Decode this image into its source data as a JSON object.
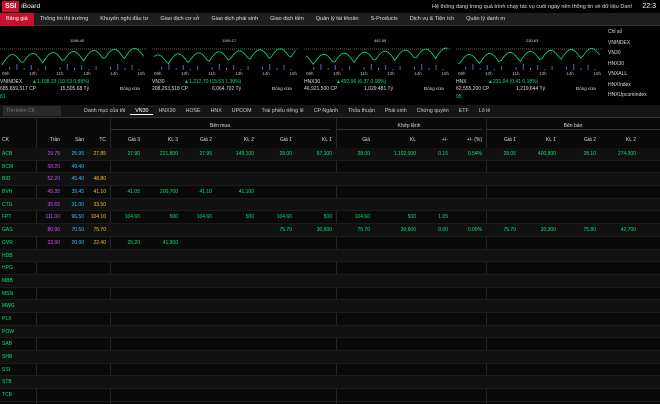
{
  "app": {
    "logo": "SSI",
    "name": "iBoard",
    "ticker_text": "Hệ thống đang trong quá trình chạy tác vụ cuối ngày nên thông tin về dữ liệu Danh m",
    "clock": "22:3"
  },
  "menu": [
    "Bảng giá",
    "Thông tin thị trường",
    "Khuyến nghị đầu tư",
    "Giao dịch cơ sở",
    "Giao dịch phái sinh",
    "Giao dịch tiền",
    "Quản lý tài khoản",
    "S-Products",
    "Dịch vụ & Tiện ích",
    "Quản lý danh m"
  ],
  "hours": [
    "09h",
    "10h",
    "11h",
    "13h",
    "14h",
    "15h"
  ],
  "indices": [
    {
      "name": "VNINDEX",
      "change": "▲1,198.33 (10.53 0.88%)",
      "vol": "685,659,517 CP",
      "val": "15,505.68 Tỷ",
      "status": "Đóng cửa",
      "peak": "1198.40",
      "advance": "81",
      "ceil": "",
      "nochange": "",
      "decline": "",
      "floor": ""
    },
    {
      "name": "VN30",
      "change": "▲1,212.70 (15.53 1.30%)",
      "vol": "208,253,518 CP",
      "val": "6,064.702 Tỷ",
      "status": "Đóng cửa",
      "peak": "1199.17",
      "advance": "",
      "ceil": "",
      "nochange": "",
      "decline": "",
      "floor": ""
    },
    {
      "name": "HNX30",
      "change": "▲492.96 (6.37 0.08%)",
      "vol": "46,921,500 CP",
      "val": "1,029.481 Tỷ",
      "status": "Đóng cửa",
      "peak": "492.59",
      "advance": "",
      "ceil": "",
      "nochange": "",
      "decline": "",
      "floor": ""
    },
    {
      "name": "HNX",
      "change": "▲231.04 (0.41 0.18%)",
      "vol": "62,555,200 CP",
      "val": "1,219,644 Tỷ",
      "status": "Đóng cửa",
      "peak": "230.63",
      "advance": "95",
      "ceil": "",
      "nochange": "",
      "decline": "",
      "floor": ""
    }
  ],
  "index_list": [
    "Chỉ số",
    "VNINDEX",
    "VN30",
    "HNX30",
    "VNXALL",
    "HNXIndex",
    "HNXUpcomIndex"
  ],
  "filter": {
    "search_placeholder": "Tìm kiếm CK",
    "tabs": [
      "Danh mục của tôi",
      "VN30",
      "HNX30",
      "HOSE",
      "HNX",
      "UPCOM",
      "Trái phiếu riêng lẻ",
      "CP Ngành",
      "Thỏa thuận",
      "Phái sinh",
      "Chứng quyền",
      "ETF",
      "Lô lẻ"
    ]
  },
  "headers": {
    "ck": "CK",
    "tran": "Trần",
    "san": "Sàn",
    "tc": "TC",
    "ben_mua": "Bên mua",
    "khop_lenh": "Khớp lệnh",
    "ben_ban": "Bên bán",
    "gia3": "Giá 3",
    "kl3": "KL 3",
    "gia2": "Giá 2",
    "kl2": "KL 2",
    "gia1": "Giá 1",
    "kl1": "KL 1",
    "gia": "Giá",
    "kl": "KL",
    "pm": "+/-",
    "pct": "+/- (%)",
    "sgia1": "Giá 1",
    "skl1": "KL 1",
    "sgia2": "Giá 2",
    "skl2": "KL 2"
  },
  "rows": [
    [
      "ACB",
      "29.75",
      "25.95",
      "27.85",
      "27.90",
      "221,800",
      "27.95",
      "149,100",
      "28.00",
      "57,100",
      "28.00",
      "1,102,000",
      "0.15",
      "0.54%",
      "28.05",
      "400,800",
      "28.10",
      "274,300"
    ],
    [
      "BCM",
      "58.20",
      "49.40",
      "",
      "",
      "",
      "",
      "",
      "",
      "",
      "",
      "",
      "",
      "",
      "",
      "",
      "",
      ""
    ],
    [
      "BID",
      "52.20",
      "45.40",
      "48.80",
      "",
      "",
      "",
      "",
      "",
      "",
      "",
      "",
      "",
      "",
      "",
      "",
      "",
      ""
    ],
    [
      "BVH",
      "45.35",
      "39.45",
      "41.10",
      "41.05",
      "200,700",
      "41.10",
      "41,100",
      "",
      "",
      "",
      "",
      "",
      "",
      "",
      "",
      "",
      ""
    ],
    [
      "CTG",
      "35.65",
      "31.00",
      "33.50",
      "",
      "",
      "",
      "",
      "",
      "",
      "",
      "",
      "",
      "",
      "",
      "",
      "",
      ""
    ],
    [
      "FPT",
      "111.00",
      "96.50",
      "104.10",
      "104.60",
      "500",
      "104.60",
      "500",
      "104.60",
      "500",
      "104.60",
      "500",
      "1.05",
      "",
      "",
      "",
      "",
      ""
    ],
    [
      "GAS",
      "80.90",
      "70.50",
      "75.70",
      "",
      "",
      "",
      "",
      "75.70",
      "30,600",
      "75.70",
      "30,600",
      "0.00",
      "0.00%",
      "75.70",
      "20,300",
      "75.80",
      "42,700"
    ],
    [
      "GVR",
      "23.90",
      "20.90",
      "22.40",
      "25.20",
      "41,900",
      "",
      "",
      "",
      "",
      "",
      "",
      "",
      "",
      "",
      "",
      "",
      ""
    ],
    [
      "HDB",
      "",
      "",
      "",
      "",
      "",
      "",
      "",
      "",
      "",
      "",
      "",
      "",
      "",
      "",
      "",
      "",
      ""
    ],
    [
      "HPG",
      "",
      "",
      "",
      "",
      "",
      "",
      "",
      "",
      "",
      "",
      "",
      "",
      "",
      "",
      "",
      "",
      ""
    ],
    [
      "MBB",
      "",
      "",
      "",
      "",
      "",
      "",
      "",
      "",
      "",
      "",
      "",
      "",
      "",
      "",
      "",
      "",
      ""
    ],
    [
      "MSN",
      "",
      "",
      "",
      "",
      "",
      "",
      "",
      "",
      "",
      "",
      "",
      "",
      "",
      "",
      "",
      "",
      ""
    ],
    [
      "MWG",
      "",
      "",
      "",
      "",
      "",
      "",
      "",
      "",
      "",
      "",
      "",
      "",
      "",
      "",
      "",
      "",
      ""
    ],
    [
      "PLX",
      "",
      "",
      "",
      "",
      "",
      "",
      "",
      "",
      "",
      "",
      "",
      "",
      "",
      "",
      "",
      "",
      ""
    ],
    [
      "POW",
      "",
      "",
      "",
      "",
      "",
      "",
      "",
      "",
      "",
      "",
      "",
      "",
      "",
      "",
      "",
      "",
      ""
    ],
    [
      "SAB",
      "",
      "",
      "",
      "",
      "",
      "",
      "",
      "",
      "",
      "",
      "",
      "",
      "",
      "",
      "",
      "",
      ""
    ],
    [
      "SHB",
      "",
      "",
      "",
      "",
      "",
      "",
      "",
      "",
      "",
      "",
      "",
      "",
      "",
      "",
      "",
      "",
      ""
    ],
    [
      "SSI",
      "",
      "",
      "",
      "",
      "",
      "",
      "",
      "",
      "",
      "",
      "",
      "",
      "",
      "",
      "",
      "",
      ""
    ],
    [
      "STB",
      "",
      "",
      "",
      "",
      "",
      "",
      "",
      "",
      "",
      "",
      "",
      "",
      "",
      "",
      "",
      "",
      ""
    ],
    [
      "TCB",
      "",
      "",
      "",
      "",
      "",
      "",
      "",
      "",
      "",
      "",
      "",
      "",
      "",
      "",
      "",
      "",
      ""
    ]
  ],
  "colors": {
    "up": "#00e676",
    "down": "#ff3b3b",
    "ref": "#f5c518",
    "ceil": "#d050ff",
    "floor": "#2ec4ff"
  }
}
